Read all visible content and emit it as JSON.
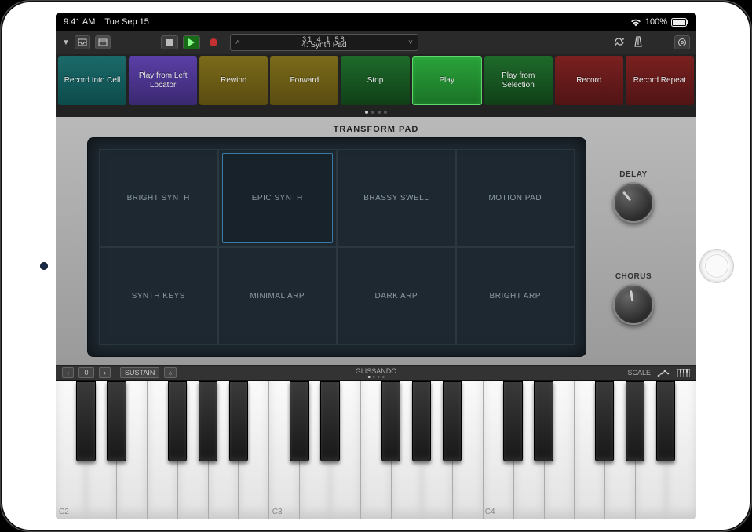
{
  "status": {
    "time": "9:41 AM",
    "date": "Tue Sep 15",
    "battery": "100%"
  },
  "lcd": {
    "position": "31  4  1    58",
    "track": "4: Synth Pad"
  },
  "commands": [
    {
      "label": "Record Into Cell",
      "color": "teal"
    },
    {
      "label": "Play from Left Locator",
      "color": "purple"
    },
    {
      "label": "Rewind",
      "color": "olive"
    },
    {
      "label": "Forward",
      "color": "olive"
    },
    {
      "label": "Stop",
      "color": "green"
    },
    {
      "label": "Play",
      "color": "brightgreen"
    },
    {
      "label": "Play from Selection",
      "color": "green"
    },
    {
      "label": "Record",
      "color": "red"
    },
    {
      "label": "Record Repeat",
      "color": "red"
    }
  ],
  "panel": {
    "title": "TRANSFORM PAD"
  },
  "cells": [
    "BRIGHT SYNTH",
    "EPIC SYNTH",
    "BRASSY SWELL",
    "MOTION PAD",
    "SYNTH KEYS",
    "MINIMAL ARP",
    "DARK ARP",
    "BRIGHT ARP"
  ],
  "selected_cell": 1,
  "knobs": {
    "delay": "DELAY",
    "chorus": "CHORUS"
  },
  "kb": {
    "octave": "0",
    "sustain": "SUSTAIN",
    "mode": "GLISSANDO",
    "scale": "SCALE",
    "oct_labels": [
      "C2",
      "C3",
      "C4"
    ]
  }
}
